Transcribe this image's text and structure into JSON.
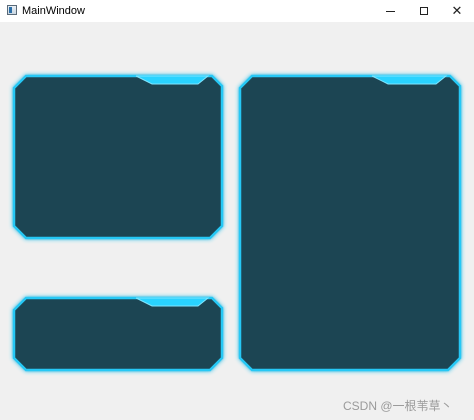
{
  "window": {
    "title": "MainWindow",
    "controls": {
      "minimize_icon": "minimize-icon",
      "maximize_icon": "maximize-icon",
      "close_icon": "close-icon"
    }
  },
  "panels": [
    {
      "id": "top-left",
      "fill": "#1a4452",
      "glow": "#27c8f5",
      "tab": "#29d3ff"
    },
    {
      "id": "bottom-left",
      "fill": "#1a4452",
      "glow": "#27c8f5",
      "tab": "#29d3ff"
    },
    {
      "id": "right",
      "fill": "#1a4452",
      "glow": "#27c8f5",
      "tab": "#29d3ff"
    }
  ],
  "watermark": {
    "text": "CSDN @一根苇草丶"
  },
  "colors": {
    "background": "#f0f0f0",
    "panel_fill": "#1a4452",
    "panel_border": "#27c8f5"
  }
}
